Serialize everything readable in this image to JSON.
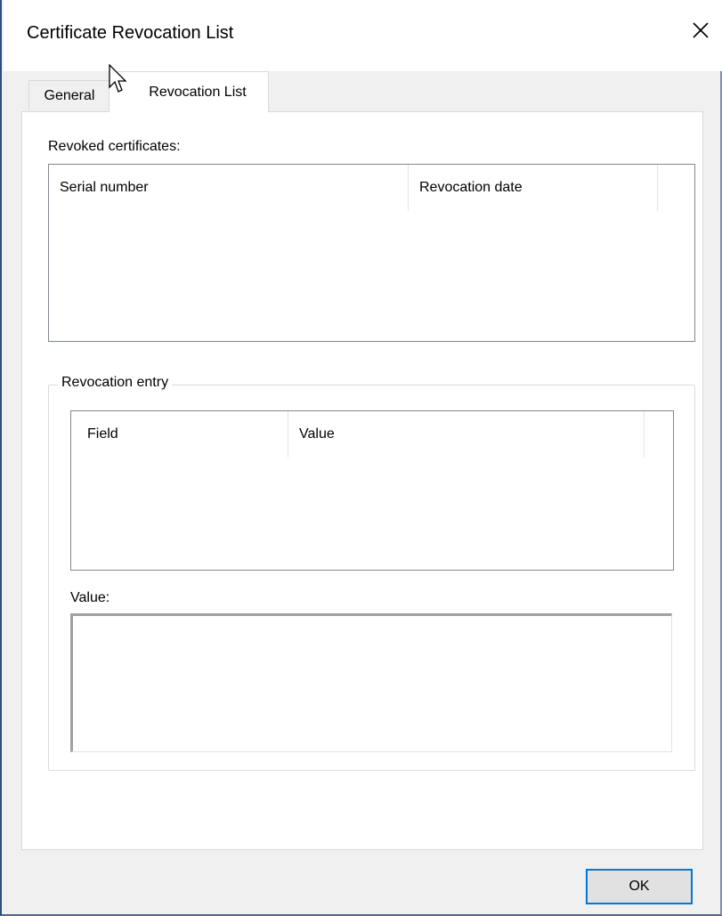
{
  "window": {
    "title": "Certificate Revocation List",
    "close_icon": "close-icon"
  },
  "tabs": [
    {
      "label": "General",
      "active": false
    },
    {
      "label": "Revocation List",
      "active": true
    }
  ],
  "revoked": {
    "label": "Revoked certificates:",
    "columns": [
      "Serial number",
      "Revocation date"
    ],
    "rows": []
  },
  "entry": {
    "group_label": "Revocation entry",
    "columns": [
      "Field",
      "Value"
    ],
    "rows": [],
    "value_label": "Value:",
    "value_text": ""
  },
  "buttons": {
    "ok_label": "OK"
  },
  "icons": {
    "cursor": "mouse-pointer-icon"
  },
  "colors": {
    "accent": "#0078d7",
    "frame": "#2b4f7a"
  }
}
